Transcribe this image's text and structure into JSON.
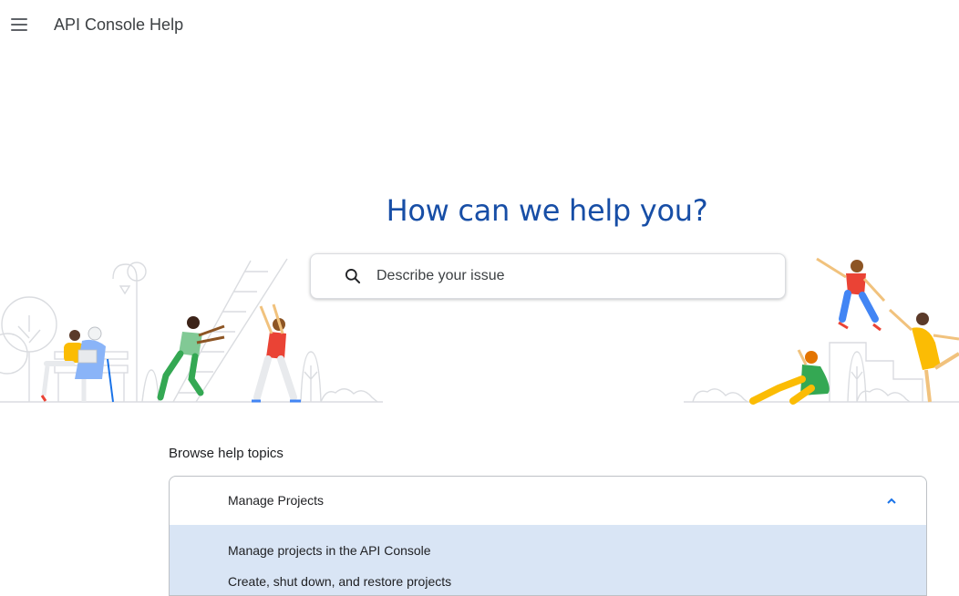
{
  "header": {
    "title": "API Console Help",
    "menu_icon": "hamburger-menu-icon"
  },
  "hero": {
    "heading": "How can we help you?"
  },
  "search": {
    "placeholder": "Describe your issue",
    "value": "",
    "icon": "search-icon"
  },
  "browse": {
    "title": "Browse help topics",
    "topics": [
      {
        "label": "Manage Projects",
        "expanded": true,
        "links": [
          "Manage projects in the API Console",
          "Create, shut down, and restore projects"
        ]
      }
    ]
  },
  "colors": {
    "heading": "#174ea6",
    "accent": "#1a73e8",
    "expanded_bg": "#d9e5f5"
  }
}
